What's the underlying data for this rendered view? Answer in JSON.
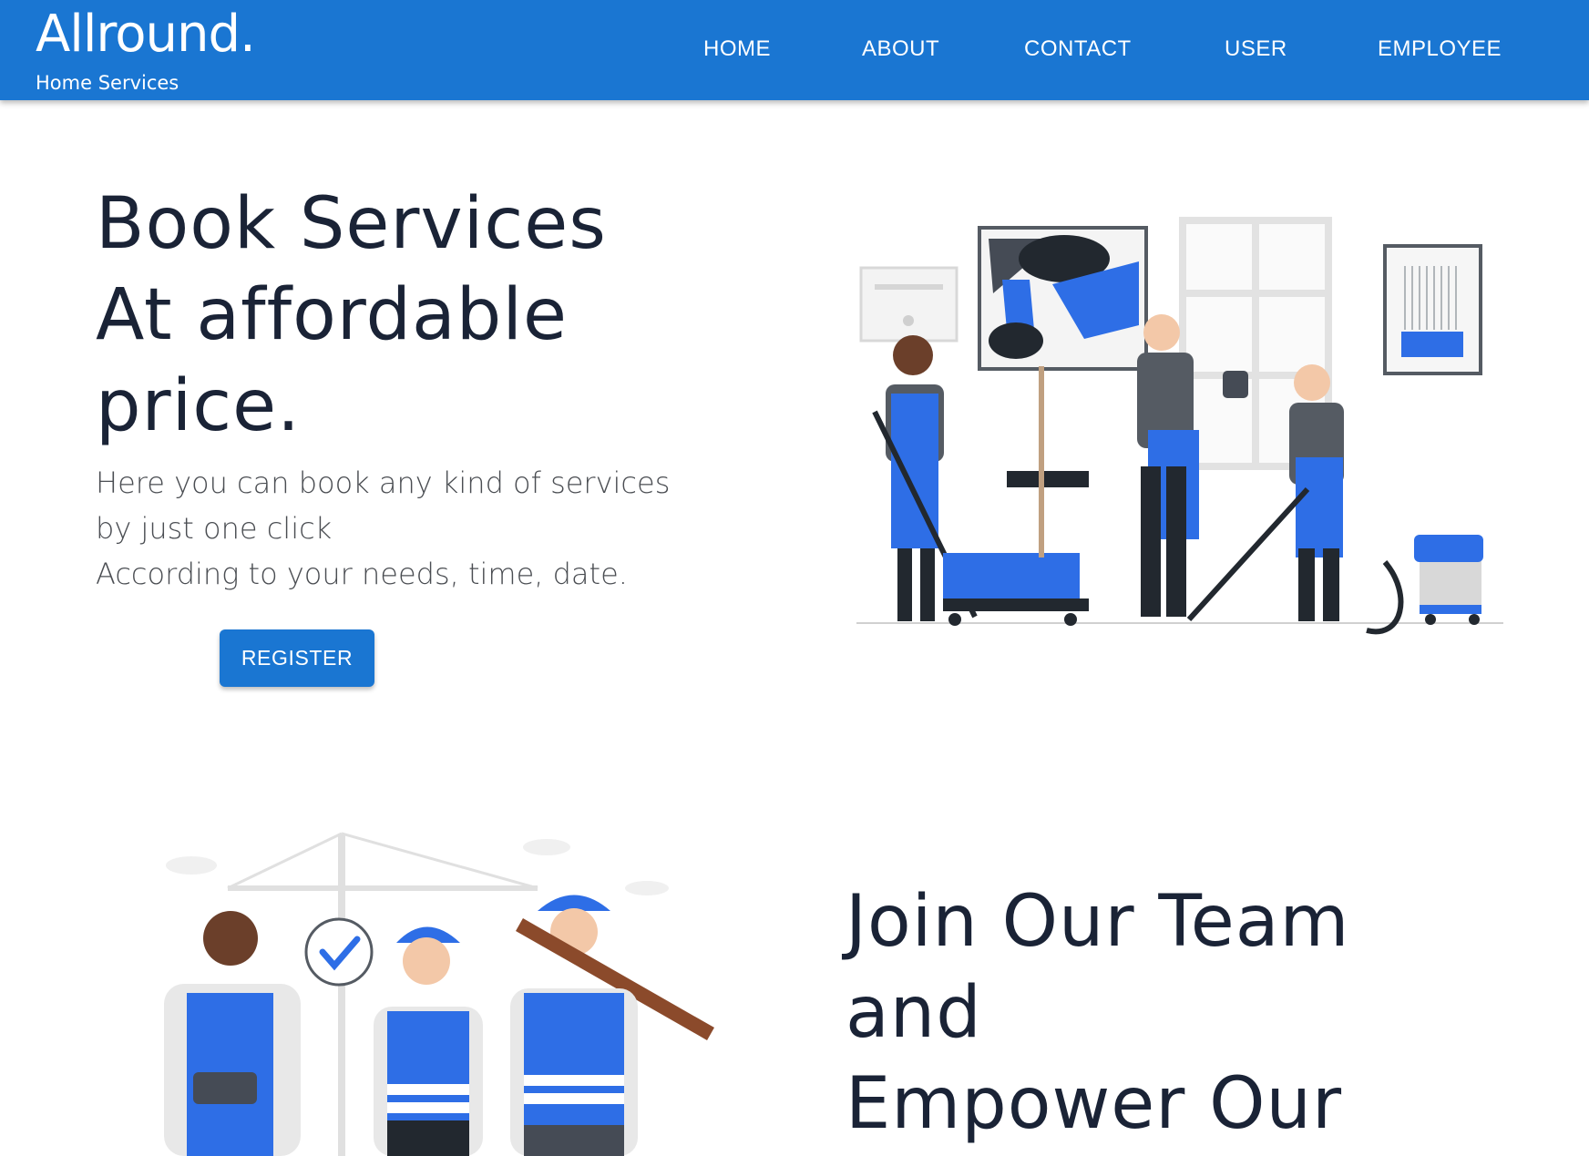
{
  "header": {
    "brand": "Allround.",
    "tagline": "Home Services",
    "nav": [
      "HOME",
      "ABOUT",
      "CONTACT",
      "USER",
      "EMPLOYEE"
    ]
  },
  "hero": {
    "title_lines": [
      "Book Services",
      "At affordable",
      "price."
    ],
    "description_lines": [
      "Here you can book any kind of services",
      "by just one click",
      "According to your needs, time, date."
    ],
    "register_label": "REGISTER"
  },
  "team": {
    "title_lines": [
      "Join Our Team",
      "and",
      "Empower Our"
    ]
  },
  "colors": {
    "primary": "#1a76d2",
    "accent_blue": "#2e6ee6",
    "heading": "#1a2336"
  }
}
